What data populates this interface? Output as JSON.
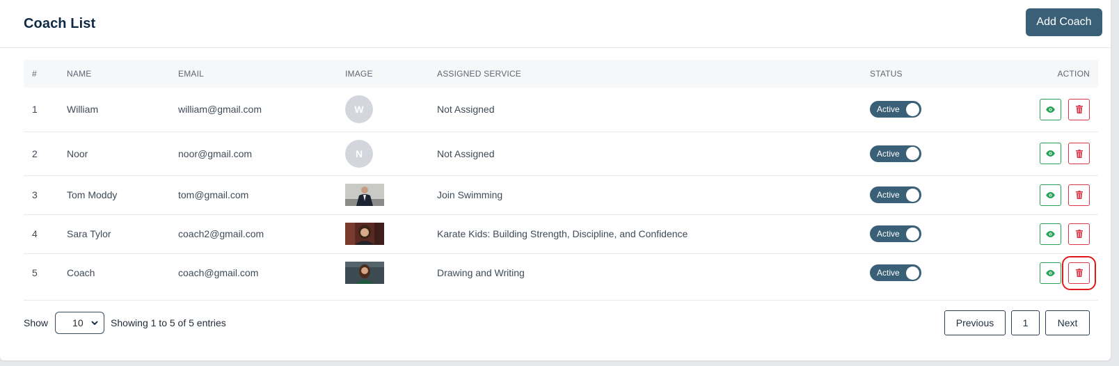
{
  "header": {
    "title": "Coach List",
    "add_label": "Add Coach"
  },
  "table": {
    "columns": [
      "#",
      "NAME",
      "EMAIL",
      "IMAGE",
      "ASSIGNED SERVICE",
      "STATUS",
      "ACTION"
    ],
    "rows": [
      {
        "num": "1",
        "name": "William",
        "email": "william@gmail.com",
        "initial": "W",
        "service": "Not Assigned",
        "status": "Active"
      },
      {
        "num": "2",
        "name": "Noor",
        "email": "noor@gmail.com",
        "initial": "N",
        "service": "Not Assigned",
        "status": "Active"
      },
      {
        "num": "3",
        "name": "Tom Moddy",
        "email": "tom@gmail.com",
        "initial": "",
        "service": "Join Swimming",
        "status": "Active"
      },
      {
        "num": "4",
        "name": "Sara Tylor",
        "email": "coach2@gmail.com",
        "initial": "",
        "service": "Karate Kids: Building Strength, Discipline, and Confidence",
        "status": "Active"
      },
      {
        "num": "5",
        "name": "Coach",
        "email": "coach@gmail.com",
        "initial": "",
        "service": "Drawing and Writing",
        "status": "Active"
      }
    ]
  },
  "footer": {
    "show_label": "Show",
    "page_size": "10",
    "info": "Showing 1 to 5 of 5 entries",
    "prev_label": "Previous",
    "page": "1",
    "next_label": "Next"
  },
  "colors": {
    "accent": "#3a6077",
    "view": "#27a155",
    "delete": "#dc3545"
  },
  "icons": {
    "view": "eye-icon",
    "delete": "trash-icon",
    "select": "chevron-down-icon"
  }
}
